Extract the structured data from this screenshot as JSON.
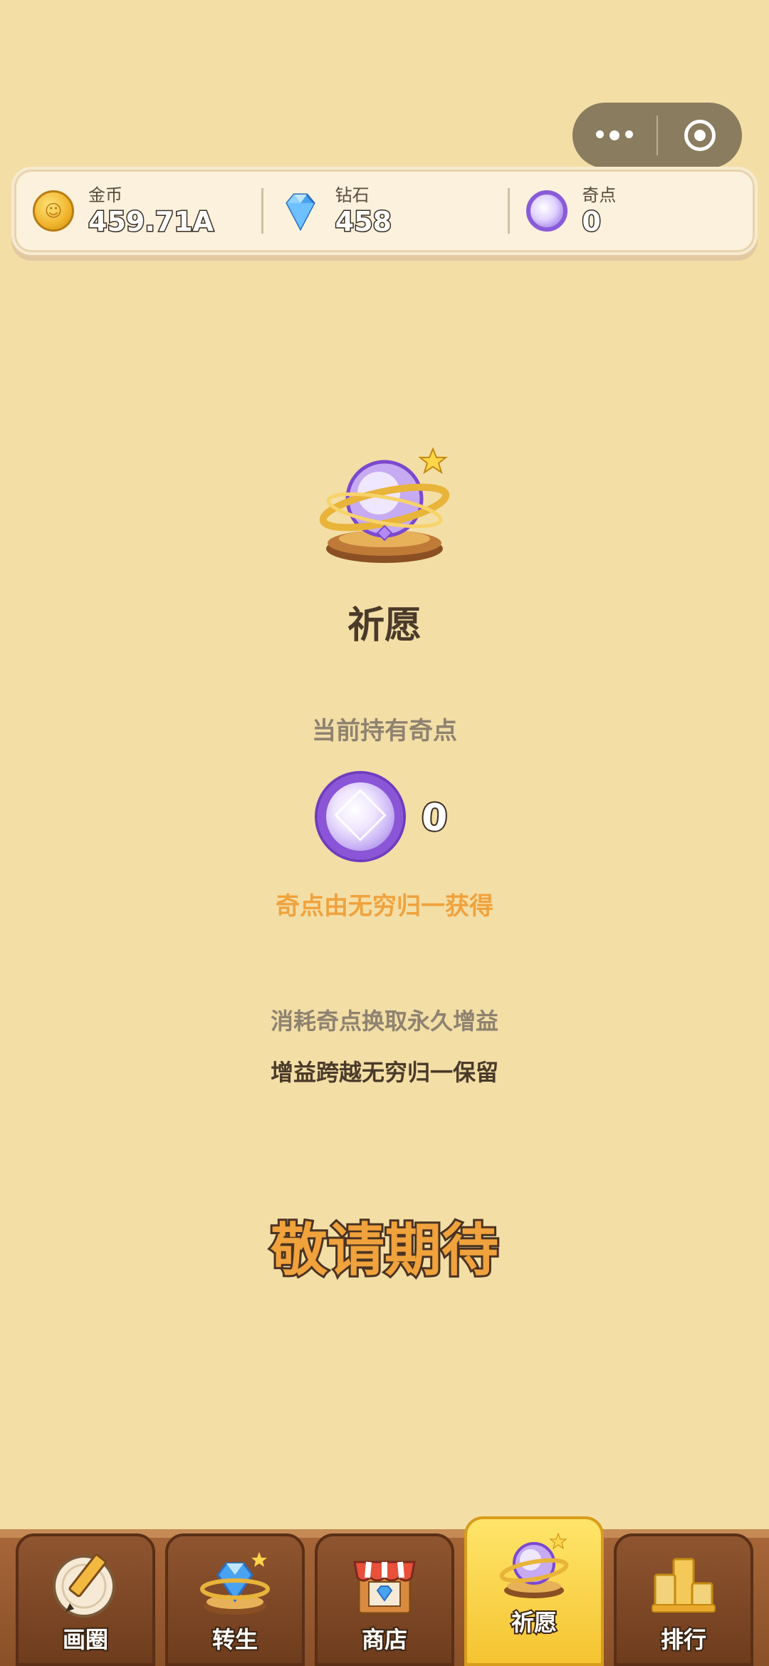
{
  "currency": {
    "gold": {
      "label": "金币",
      "value": "459.71A"
    },
    "diamond": {
      "label": "钻石",
      "value": "458"
    },
    "qidian": {
      "label": "奇点",
      "value": "0"
    }
  },
  "wish": {
    "title": "祈愿",
    "held_label": "当前持有奇点",
    "held_value": "0",
    "source_note": "奇点由无穷归一获得",
    "consume_note": "消耗奇点换取永久增益",
    "keep_note": "增益跨越无穷归一保留",
    "coming_soon": "敬请期待"
  },
  "tabs": [
    {
      "label": "画圈",
      "icon": "pencil-icon"
    },
    {
      "label": "转生",
      "icon": "rebirth-gem-icon"
    },
    {
      "label": "商店",
      "icon": "shop-icon"
    },
    {
      "label": "祈愿",
      "icon": "wish-orb-icon",
      "active": true
    },
    {
      "label": "排行",
      "icon": "podium-icon"
    }
  ],
  "colors": {
    "background": "#f3dea6",
    "accent_orange": "#f0a23c",
    "active_tab": "#f5c431",
    "tab_brown": "#8f5530",
    "orb_purple": "#8a55d6"
  }
}
